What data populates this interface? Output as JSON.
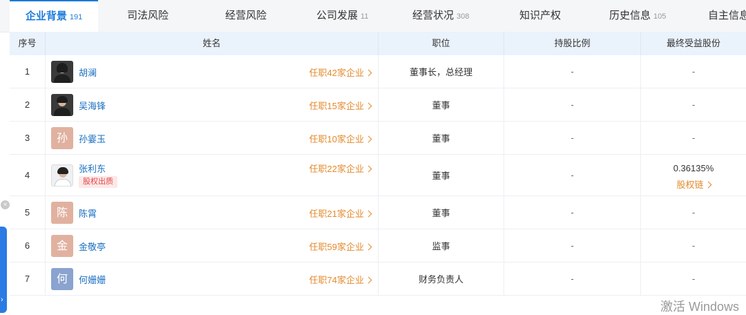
{
  "tabs": [
    {
      "label": "企业背景",
      "count": "191",
      "active": true
    },
    {
      "label": "司法风险",
      "count": ""
    },
    {
      "label": "经营风险",
      "count": ""
    },
    {
      "label": "公司发展",
      "count": "11"
    },
    {
      "label": "经营状况",
      "count": "308"
    },
    {
      "label": "知识产权",
      "count": ""
    },
    {
      "label": "历史信息",
      "count": "105"
    },
    {
      "label": "自主信息",
      "count": ""
    }
  ],
  "table": {
    "headers": {
      "index": "序号",
      "name": "姓名",
      "position": "职位",
      "share_ratio": "持股比例",
      "final_benefit": "最终受益股份"
    },
    "rows": [
      {
        "index": "1",
        "avatar": "photo",
        "name": "胡澜",
        "positions": "任职42家企业",
        "role": "董事长，总经理",
        "share_ratio": "-",
        "final_benefit": "-"
      },
      {
        "index": "2",
        "avatar": "photo",
        "name": "吴海锋",
        "positions": "任职15家企业",
        "role": "董事",
        "share_ratio": "-",
        "final_benefit": "-"
      },
      {
        "index": "3",
        "avatar_char": "孙",
        "name": "孙霎玉",
        "positions": "任职10家企业",
        "role": "董事",
        "share_ratio": "-",
        "final_benefit": "-"
      },
      {
        "index": "4",
        "avatar": "photo",
        "name": "张利东",
        "tag": "股权出质",
        "positions": "任职22家企业",
        "role": "董事",
        "share_ratio": "-",
        "final_benefit": "0.36135%",
        "final_link": "股权链"
      },
      {
        "index": "5",
        "avatar_char": "陈",
        "name": "陈霄",
        "positions": "任职21家企业",
        "role": "董事",
        "share_ratio": "-",
        "final_benefit": "-"
      },
      {
        "index": "6",
        "avatar_char": "金",
        "name": "金敬亭",
        "positions": "任职59家企业",
        "role": "监事",
        "share_ratio": "-",
        "final_benefit": "-"
      },
      {
        "index": "7",
        "avatar_char": "何",
        "name": "何姗姗",
        "positions": "任职74家企业",
        "role": "财务负责人",
        "share_ratio": "-",
        "final_benefit": "-"
      }
    ]
  },
  "overlay": {
    "close_glyph": "×",
    "watermark": "激活 Windows"
  },
  "colors": {
    "accent": "#1a7ad9",
    "link": "#1a6fc2",
    "orange": "#e38a2c",
    "tag_red": "#e04848",
    "header_bg": "#eaf2fc",
    "avatar_pink": "#e1b1a0",
    "avatar_blue": "#8aa3cf"
  }
}
